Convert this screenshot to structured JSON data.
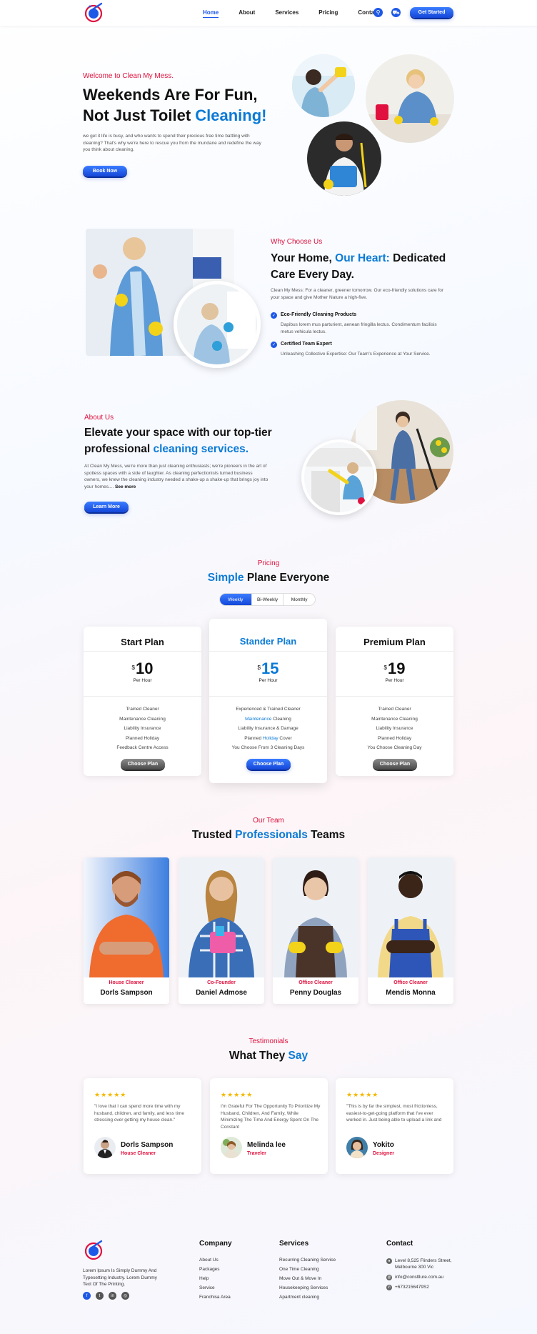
{
  "nav": {
    "links": [
      "Home",
      "About",
      "Services",
      "Pricing",
      "Contact"
    ],
    "active": "Home",
    "cta": "Get Started"
  },
  "hero": {
    "eyebrow": "Welcome to Clean My Mess.",
    "title_line1": "Weekends Are For Fun,",
    "title_line2_plain": "Not Just Toilet ",
    "title_line2_accent": "Cleaning!",
    "body": "we get it life is busy, and who wants to spend their precious free time battling with cleaning? That's why we're here to rescue you from the mundane and redefine the way you think about cleaning.",
    "button": "Book Now"
  },
  "why": {
    "eyebrow": "Why Choose Us",
    "title_a": "Your Home, ",
    "title_accent": "Our Heart:",
    "title_b": " Dedicated",
    "title_line2": "Care Every Day.",
    "body": "Clean My Mess: For a cleaner, greener tomorrow. Our eco-friendly solutions care for your space and give Mother Nature a high-five.",
    "features": [
      {
        "title": "Eco-Friendly Cleaning Products",
        "text": "Dapibus lorem mus parturient, aenean fringilla lectus. Condimentum facilisis metus vehicula lectus."
      },
      {
        "title": "Certified Team Expert",
        "text": "Unleashing Collective Expertise: Our Team's Experience at Your Service."
      }
    ]
  },
  "about": {
    "eyebrow": "About Us",
    "title_line1": "Elevate your space with our top-tier",
    "title_line2_plain": "professional ",
    "title_line2_accent": "cleaning services.",
    "body": "At Clean My Mess, we're more than just cleaning enthusiasts; we're pioneers in the art of spotless spaces with a side of laughter. As cleaning perfectionists turned business owners, we knew the cleaning industry needed a shake-up a shake-up that brings joy into your homes....",
    "see_more": "See more",
    "button": "Learn More"
  },
  "pricing": {
    "eyebrow": "Pricing",
    "title_accent": "Simple",
    "title_plain": " Plane Everyone",
    "tabs": [
      "Weekly",
      "Bi-Weekly",
      "Monthly"
    ],
    "active_tab": "Weekly",
    "plans": [
      {
        "name": "Start Plan",
        "currency": "$",
        "price": "10",
        "per": "Per Hour",
        "features": [
          "Trained Cleaner",
          "Maintenance Cleaning",
          "Liability Insurance",
          "Planned Holiday",
          "Feedback Centre Access"
        ],
        "button": "Choose Plan",
        "featured": false
      },
      {
        "name": "Stander Plan",
        "currency": "$",
        "price": "15",
        "per": "Per Hour",
        "features": [
          "Experienced & Trained Cleaner",
          "Maintenance Cleaning",
          "Liability Insurance & Damage",
          "Planned Holiday Cover",
          "You Choose From 3 Cleaning Days"
        ],
        "button": "Choose Plan",
        "featured": true
      },
      {
        "name": "Premium Plan",
        "currency": "$",
        "price": "19",
        "per": "Per Hour",
        "features": [
          "Trained Cleaner",
          "Maintenance Cleaning",
          "Liability Insurance",
          "Planned Holiday",
          "You Choose Cleaning Day"
        ],
        "button": "Choose Plan",
        "featured": false
      }
    ]
  },
  "team": {
    "eyebrow": "Our Team",
    "title_a": "Trusted ",
    "title_accent": "Professionals",
    "title_b": " Teams",
    "members": [
      {
        "role": "House Cleaner",
        "name": "Dorls Sampson"
      },
      {
        "role": "Co-Founder",
        "name": "Daniel Admose"
      },
      {
        "role": "Office Cleaner",
        "name": "Penny Douglas"
      },
      {
        "role": "Office Cleaner",
        "name": "Mendis Monna"
      }
    ]
  },
  "testimonials": {
    "eyebrow": "Testimonials",
    "title_a": "What They ",
    "title_accent": "Say",
    "stars": "★★★★★",
    "items": [
      {
        "quote": "\"I love that I can spend more time with my husband, children, and family, and less time stressing over getting my house clean.\"",
        "name": "Dorls Sampson",
        "role": "House Cleaner"
      },
      {
        "quote": "I'm Grateful For The Opportunity To Prioritize My Husband, Children, And Family, While Minimizing The Time And Energy Spent On The Constant",
        "name": "Melinda lee",
        "role": "Traveler"
      },
      {
        "quote": "\"This is by far the simplest, most frictionless, easiest-to-get-going platform that I've ever worked in. Just being able to upload a link and",
        "name": "Yokito",
        "role": "Designer"
      }
    ]
  },
  "footer": {
    "about_text": "Lorem Ipsum Is Simply Dummy And Typesetting Industry. Lorem Dummy Text Of The Printing.",
    "company_title": "Company",
    "company_links": [
      "About Us",
      "Packages",
      "Help",
      "Service",
      "Franchisa Area"
    ],
    "services_title": "Services",
    "services_links": [
      "Recurring Cleaning Service",
      "One Time Cleaning",
      "Move Out & Move In",
      "Housekeeping Services",
      "Apartment cleaning"
    ],
    "contact_title": "Contact",
    "address": "Level 8,525 Flinders Street, Melbourne 300 Vic",
    "email": "info@constllure.com.au",
    "phone": "+6732156479S2"
  },
  "colors": {
    "accent": "#0a7ad6",
    "highlight": "#e0113e",
    "button": "#1e58e6"
  }
}
